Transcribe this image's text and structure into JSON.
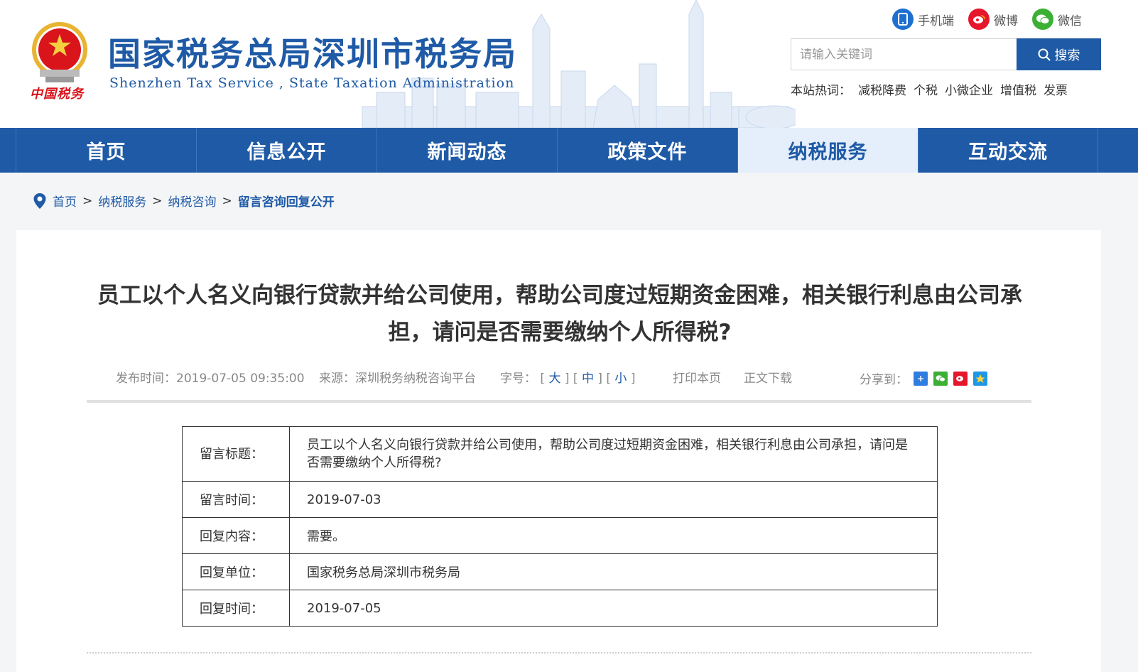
{
  "header": {
    "site_title": "国家税务总局深圳市税务局",
    "site_subtitle": "Shenzhen Tax Service , State Taxation Administration",
    "logo_text": "中国税务",
    "top_links": [
      {
        "label": "手机端",
        "icon": "mobile-icon",
        "color": "#1f6fd1"
      },
      {
        "label": "微博",
        "icon": "weibo-icon",
        "color": "#e6162d"
      },
      {
        "label": "微信",
        "icon": "wechat-icon",
        "color": "#3cb035"
      }
    ],
    "search": {
      "placeholder": "请输入关键词",
      "button_label": "搜索"
    },
    "hot": {
      "label": "本站热词：",
      "words": [
        "减税降费",
        "个税",
        "小微企业",
        "增值税",
        "发票"
      ]
    }
  },
  "nav": {
    "items": [
      "首页",
      "信息公开",
      "新闻动态",
      "政策文件",
      "纳税服务",
      "互动交流"
    ],
    "active_index": 4
  },
  "breadcrumb": [
    "首页",
    "纳税服务",
    "纳税咨询",
    "留言咨询回复公开"
  ],
  "article": {
    "title": "员工以个人名义向银行贷款并给公司使用，帮助公司度过短期资金困难，相关银行利息由公司承担，请问是否需要缴纳个人所得税?",
    "meta": {
      "publish_time": "发布时间：2019-07-05 09:35:00",
      "source": "来源：深圳税务纳税咨询平台",
      "font_label": "字号：",
      "font_large": "大",
      "font_medium": "中",
      "font_small": "小",
      "print": "打印本页",
      "download": "正文下载",
      "share_label": "分享到："
    },
    "table": [
      {
        "label": "留言标题：",
        "value": "员工以个人名义向银行贷款并给公司使用，帮助公司度过短期资金困难，相关银行利息由公司承担，请问是否需要缴纳个人所得税?"
      },
      {
        "label": "留言时间：",
        "value": "2019-07-03"
      },
      {
        "label": "回复内容：",
        "value": "需要。"
      },
      {
        "label": "回复单位：",
        "value": "国家税务总局深圳市税务局"
      },
      {
        "label": "回复时间：",
        "value": "2019-07-05"
      }
    ]
  },
  "colors": {
    "brand": "#1f5aa6",
    "nav_active_bg": "#e5eefb",
    "emblem_red": "#d9141b"
  }
}
